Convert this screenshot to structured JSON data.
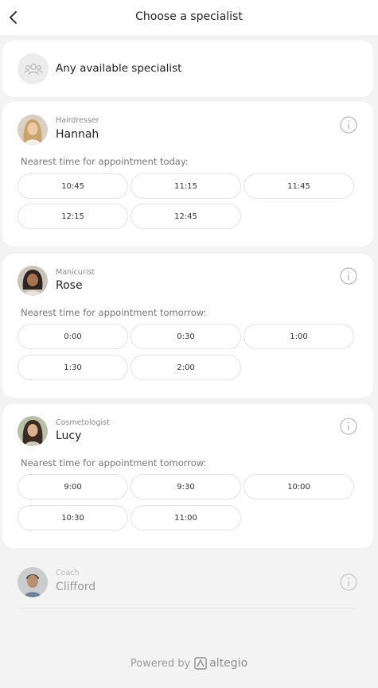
{
  "header": {
    "title": "Choose a specialist",
    "back_icon": "chevron-left-icon"
  },
  "any_specialist": {
    "label": "Any available specialist",
    "icon": "group-icon"
  },
  "specialists": [
    {
      "role": "Hairdresser",
      "name": "Hannah",
      "nearest": "Nearest time for appointment today:",
      "slots": [
        "10:45",
        "11:15",
        "11:45",
        "12:15",
        "12:45"
      ]
    },
    {
      "role": "Manicurist",
      "name": "Rose",
      "nearest": "Nearest time for appointment tomorrow:",
      "slots": [
        "0:00",
        "0:30",
        "1:00",
        "1:30",
        "2:00"
      ]
    },
    {
      "role": "Cosmetologist",
      "name": "Lucy",
      "nearest": "Nearest time for appointment tomorrow:",
      "slots": [
        "9:00",
        "9:30",
        "10:00",
        "10:30",
        "11:00"
      ]
    },
    {
      "role": "Coach",
      "name": "Clifford"
    }
  ],
  "footer": {
    "powered_by": "Powered by",
    "brand": "altegio"
  },
  "colors": {
    "background": "#f3f3f3",
    "card": "#ffffff",
    "slot_border": "#e3e3e3",
    "muted_text": "#8a8a8a"
  }
}
